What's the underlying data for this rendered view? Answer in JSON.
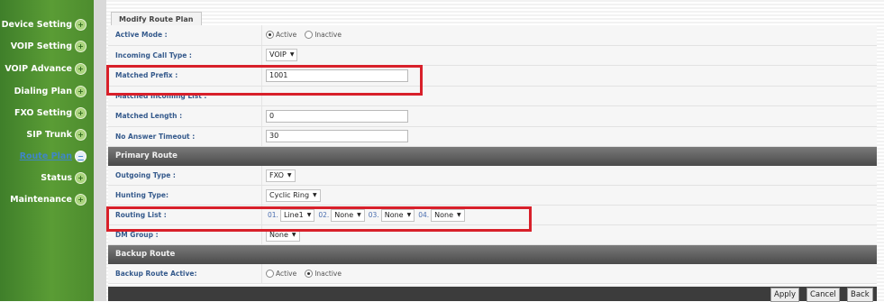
{
  "sidebar": {
    "items": [
      {
        "label": "Device Setting",
        "icon": "plus-circle-icon",
        "active": false
      },
      {
        "label": "VOIP Setting",
        "icon": "plus-circle-icon",
        "active": false
      },
      {
        "label": "VOIP Advance",
        "icon": "plus-circle-icon",
        "active": false
      },
      {
        "label": "Dialing Plan",
        "icon": "plus-circle-icon",
        "active": false
      },
      {
        "label": "FXO Setting",
        "icon": "plus-circle-icon",
        "active": false
      },
      {
        "label": "SIP Trunk",
        "icon": "plus-circle-icon",
        "active": false
      },
      {
        "label": "Route Plan",
        "icon": "minus-circle-icon",
        "active": true
      },
      {
        "label": "Status",
        "icon": "plus-circle-icon",
        "active": false
      },
      {
        "label": "Maintenance",
        "icon": "plus-circle-icon",
        "active": false
      }
    ]
  },
  "tab": {
    "label": "Modify Route Plan"
  },
  "form": {
    "active_mode": {
      "label": "Active Mode :",
      "options": [
        "Active",
        "Inactive"
      ],
      "selected": "Active"
    },
    "incoming_call_type": {
      "label": "Incoming Call Type :",
      "value": "VOIP"
    },
    "matched_prefix": {
      "label": "Matched Prefix :",
      "value": "1001"
    },
    "matched_incoming_list": {
      "label": "Matched Incoming List :"
    },
    "matched_length": {
      "label": "Matched Length :",
      "value": "0"
    },
    "no_answer_timeout": {
      "label": "No Answer Timeout :",
      "value": "30"
    }
  },
  "primary_route": {
    "title": "Primary Route",
    "outgoing_type": {
      "label": "Outgoing Type :",
      "value": "FXO"
    },
    "hunting_type": {
      "label": "Hunting Type:",
      "value": "Cyclic Ring"
    },
    "routing_list": {
      "label": "Routing List :",
      "entries": [
        {
          "num": "01.",
          "value": "Line1"
        },
        {
          "num": "02.",
          "value": "None"
        },
        {
          "num": "03.",
          "value": "None"
        },
        {
          "num": "04.",
          "value": "None"
        }
      ]
    },
    "dm_group": {
      "label": "DM Group :",
      "value": "None"
    }
  },
  "backup_route": {
    "title": "Backup Route",
    "backup_route_active": {
      "label": "Backup Route Active:",
      "options": [
        "Active",
        "Inactive"
      ],
      "selected": "Inactive"
    }
  },
  "buttons": {
    "apply": "Apply",
    "cancel": "Cancel",
    "back": "Back"
  },
  "colors": {
    "sidebar_green": "#4d8c2e",
    "section_dark": "#4a4a4a",
    "label_blue": "#355a8c",
    "highlight_red": "#d8202a"
  }
}
